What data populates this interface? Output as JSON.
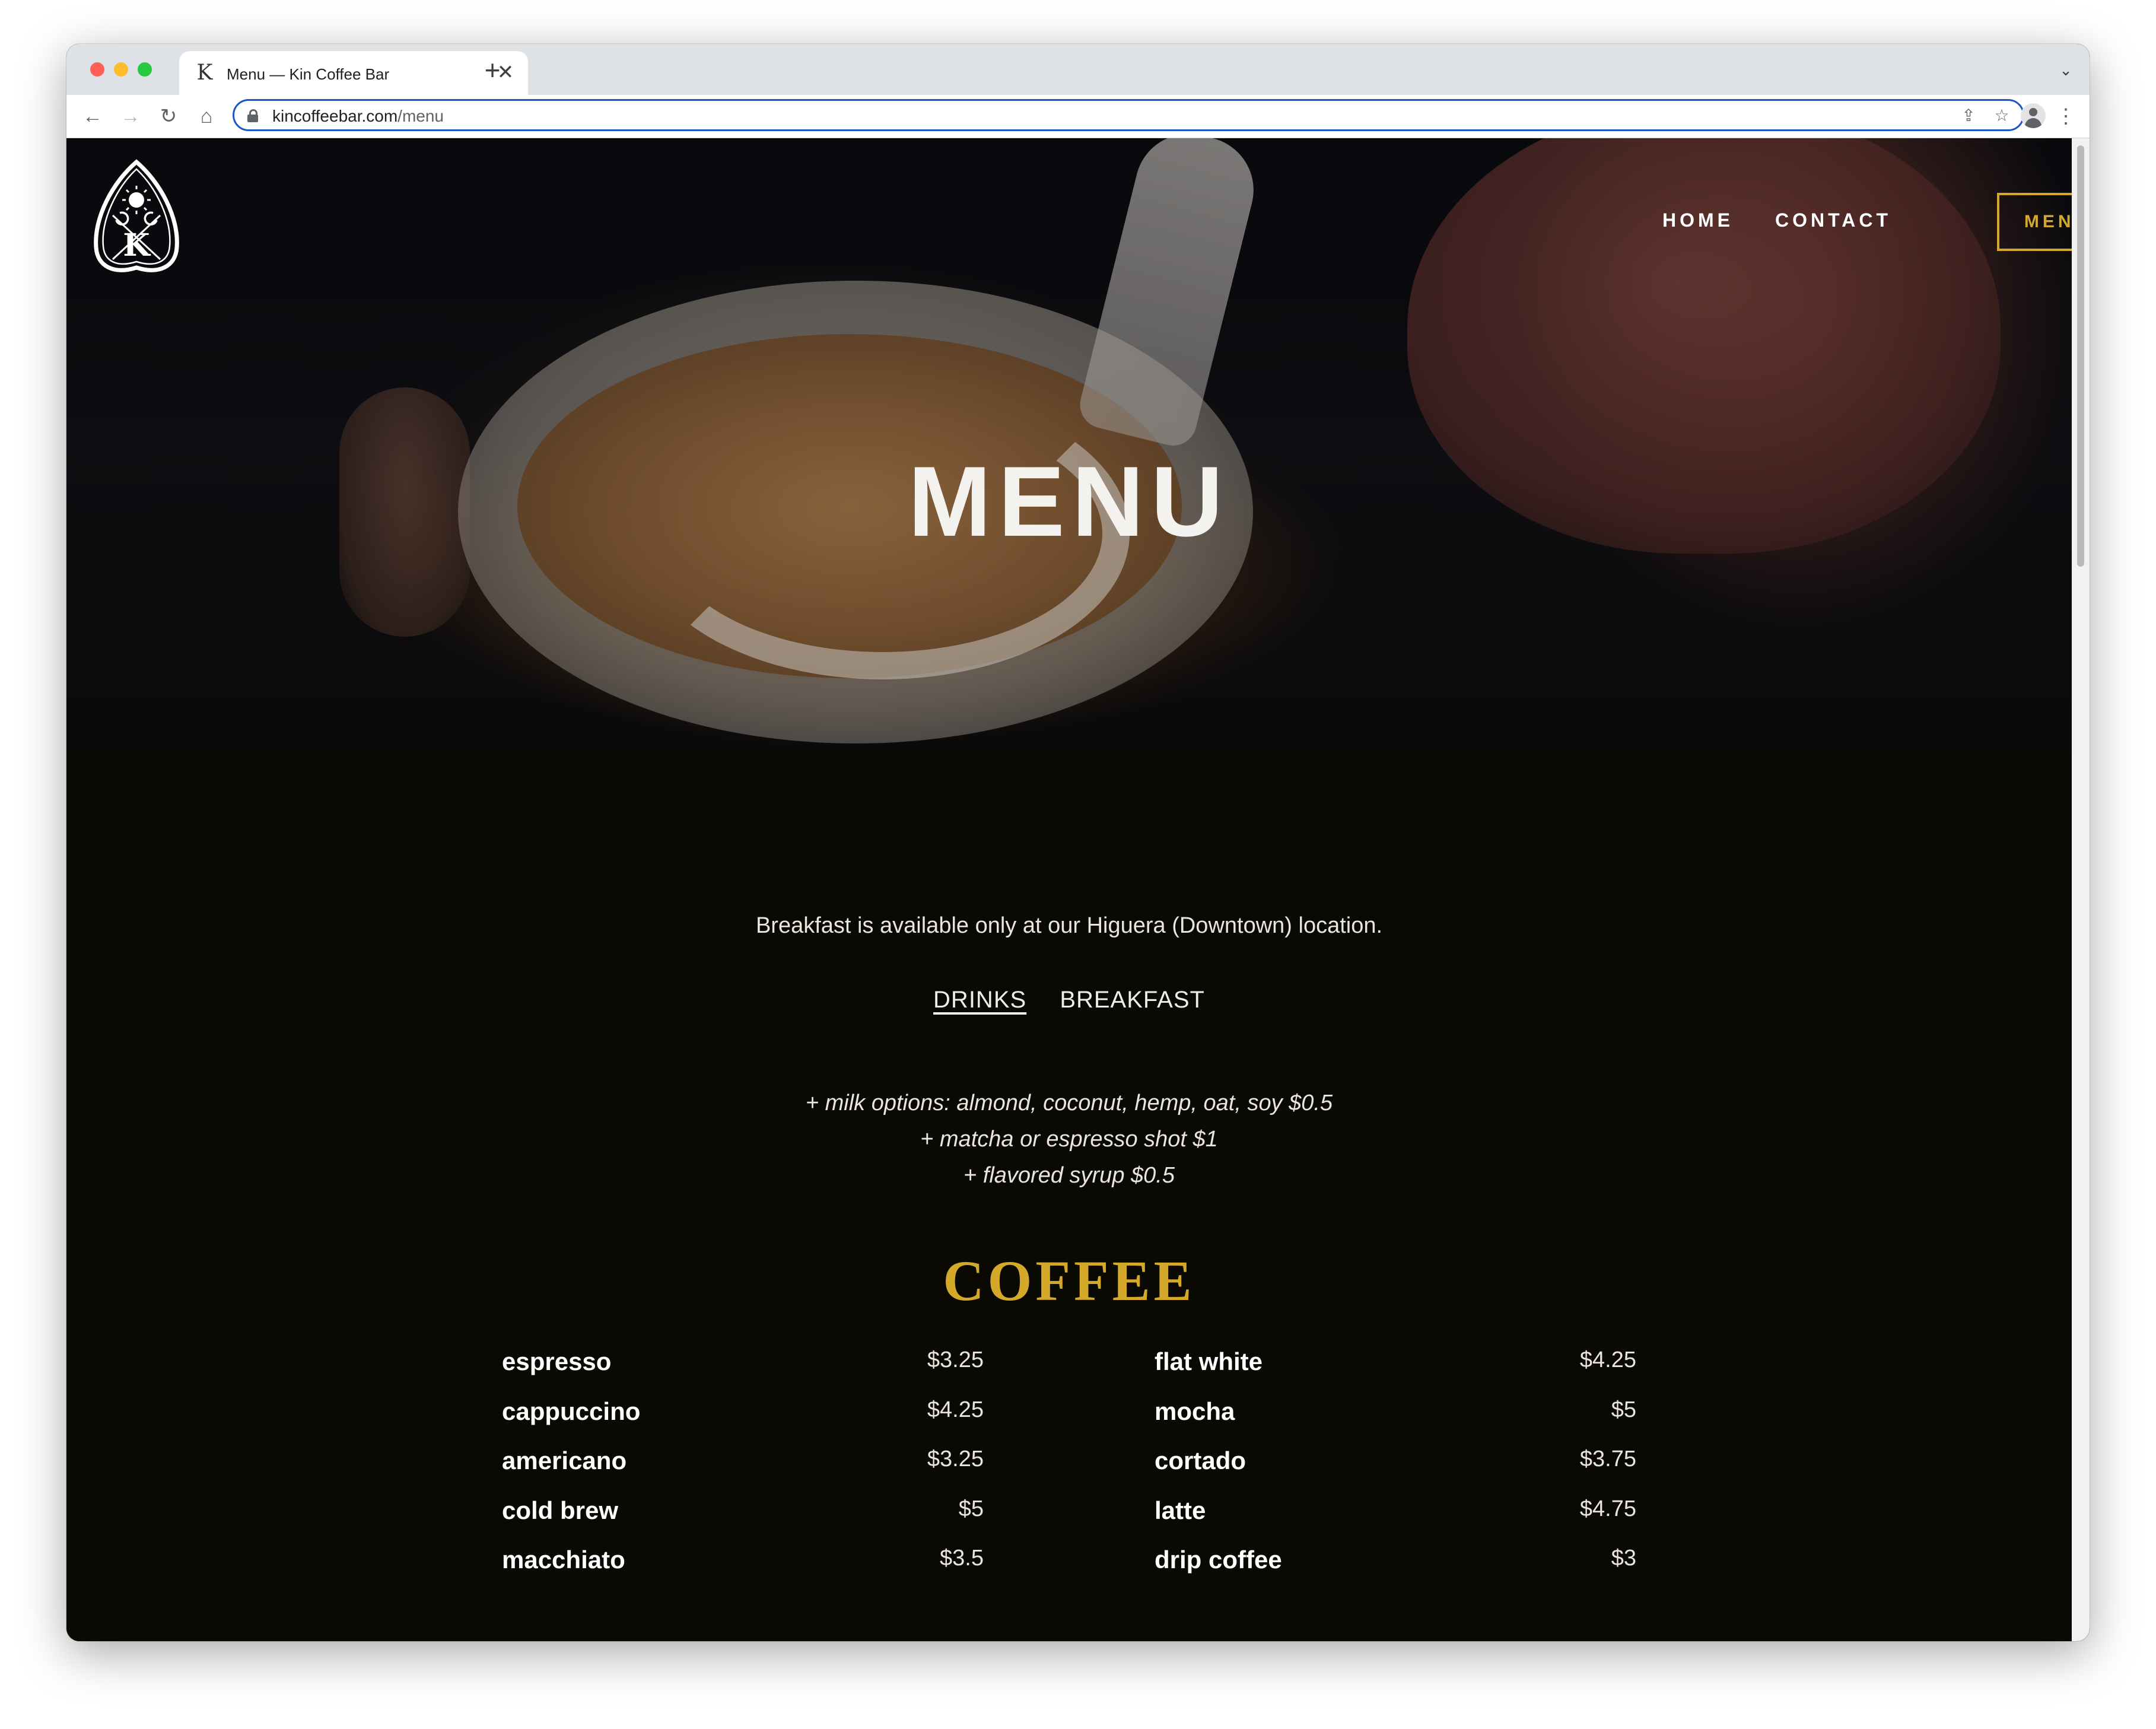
{
  "browser": {
    "tab_title": "Menu — Kin Coffee Bar",
    "url_domain": "kincoffeebar.com",
    "url_path": "/menu",
    "close_glyph": "✕",
    "new_tab_glyph": "+",
    "back_glyph": "←",
    "forward_glyph": "→",
    "reload_glyph": "↻",
    "home_glyph": "⌂",
    "share_glyph": "⇪",
    "star_glyph": "☆",
    "menu_glyph": "⋮",
    "tab_search_glyph": "⌄",
    "favicon_glyph": "K"
  },
  "site": {
    "logo_letter": "K",
    "nav": {
      "home": "HOME",
      "contact": "CONTACT",
      "menu": "MENU"
    },
    "accent_color": "#d4a92a"
  },
  "hero": {
    "title": "MENU"
  },
  "menu": {
    "intro": "Breakfast is available only at our Higuera (Downtown) location.",
    "tabs": [
      "DRINKS",
      "BREAKFAST"
    ],
    "active_tab": "DRINKS",
    "addons": [
      "+ milk options: almond, coconut, hemp, oat, soy $0.5",
      "+ matcha or espresso shot $1",
      "+ flavored syrup $0.5"
    ],
    "section_title": "COFFEE",
    "left_items": [
      {
        "name": "espresso",
        "price": "$3.25"
      },
      {
        "name": "cappuccino",
        "price": "$4.25"
      },
      {
        "name": "americano",
        "price": "$3.25"
      },
      {
        "name": "cold brew",
        "price": "$5"
      },
      {
        "name": "macchiato",
        "price": "$3.5"
      }
    ],
    "right_items": [
      {
        "name": "flat white",
        "price": "$4.25"
      },
      {
        "name": "mocha",
        "price": "$5"
      },
      {
        "name": "cortado",
        "price": "$3.75"
      },
      {
        "name": "latte",
        "price": "$4.75"
      },
      {
        "name": "drip coffee",
        "price": "$3"
      }
    ]
  }
}
